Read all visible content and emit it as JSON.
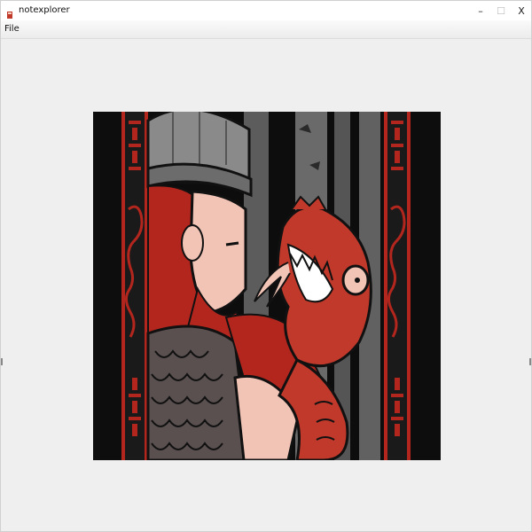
{
  "window": {
    "title": "notexplorer",
    "minimize_label": "–",
    "maximize_label": "☐",
    "close_label": "X"
  },
  "menubar": {
    "items": [
      {
        "label": "File"
      }
    ]
  },
  "viewer": {
    "image_icon": "viking-and-dragon-illustration-icon"
  },
  "colors": {
    "titlebar_bg": "#ffffff",
    "content_bg": "#efefef",
    "art_red": "#b3261e",
    "art_dark": "#1a1a1a",
    "art_gray": "#6a6a6a"
  }
}
